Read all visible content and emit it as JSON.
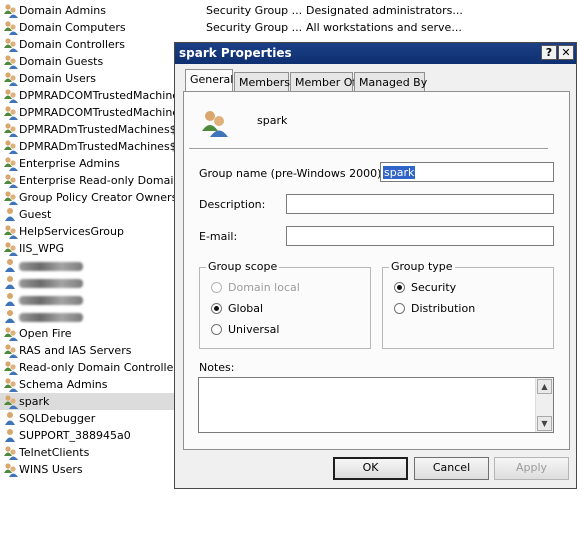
{
  "background_list": {
    "rows": [
      {
        "name": "Domain Admins",
        "type": "Security Group ...",
        "description": "Designated administrators..."
      },
      {
        "name": "Domain Computers",
        "type": "Security Group ...",
        "description": "All workstations and serve..."
      },
      {
        "name": "Domain Controllers"
      },
      {
        "name": "Domain Guests"
      },
      {
        "name": "Domain Users"
      },
      {
        "name": "DPMRADCOMTrustedMachines$C"
      },
      {
        "name": "DPMRADCOMTrustedMachines$C"
      },
      {
        "name": "DPMRADmTrustedMachines$CET"
      },
      {
        "name": "DPMRADmTrustedMachines$CET"
      },
      {
        "name": "Enterprise Admins"
      },
      {
        "name": "Enterprise Read-only Domain Co"
      },
      {
        "name": "Group Policy Creator Owners"
      },
      {
        "name": "Guest"
      },
      {
        "name": "HelpServicesGroup"
      },
      {
        "name": "IIS_WPG"
      },
      {
        "name": ""
      },
      {
        "name": ""
      },
      {
        "name": ""
      },
      {
        "name": ""
      },
      {
        "name": "Open Fire"
      },
      {
        "name": "RAS and IAS Servers"
      },
      {
        "name": "Read-only Domain Controllers"
      },
      {
        "name": "Schema Admins"
      },
      {
        "name": "spark"
      },
      {
        "name": "SQLDebugger"
      },
      {
        "name": "SUPPORT_388945a0"
      },
      {
        "name": "TelnetClients"
      },
      {
        "name": "WINS Users"
      }
    ],
    "selected_index": 23
  },
  "dialog": {
    "title": "spark Properties",
    "help_button": "?",
    "close_button": "✕",
    "tabs": [
      "General",
      "Members",
      "Member Of",
      "Managed By"
    ],
    "active_tab": "General",
    "object_name": "spark",
    "group_name_label": "Group name (pre-Windows 2000):",
    "group_name_value": "spark",
    "description_label": "Description:",
    "description_value": "",
    "email_label": "E-mail:",
    "email_value": "",
    "group_scope": {
      "title": "Group scope",
      "options": [
        "Domain local",
        "Global",
        "Universal"
      ],
      "selected": "Global",
      "disabled": [
        "Domain local"
      ]
    },
    "group_type": {
      "title": "Group type",
      "options": [
        "Security",
        "Distribution"
      ],
      "selected": "Security"
    },
    "notes_label": "Notes:",
    "notes_value": "",
    "buttons": {
      "ok": "OK",
      "cancel": "Cancel",
      "apply": "Apply"
    }
  }
}
